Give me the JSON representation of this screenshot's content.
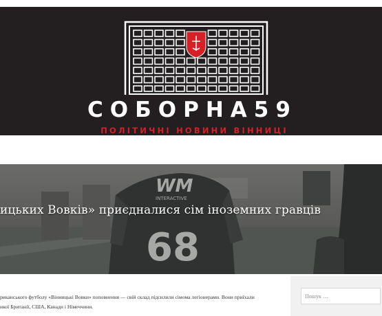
{
  "header": {
    "site_title": "СОБОРНА59",
    "tagline": "ПОЛІТИЧНІ НОВИНИ ВІННИЦІ",
    "background": "#231f20",
    "accent": "#d71f26"
  },
  "hero": {
    "title": "ицьких Вовків» приєдналися сім іноземних гравців",
    "jersey_brand": "WM",
    "jersey_sub": "INTERACTIVE",
    "jersey_number": "68"
  },
  "article": {
    "excerpt_line1": "риканського футболу «Вінницькі Вовки» поповнення — свій склад підсилили сімома легіонерами. Вони приїхали",
    "excerpt_line2": "икої Британії, США, Канади і Німеччини."
  },
  "sidebar": {
    "search_placeholder": "Пошук …"
  }
}
